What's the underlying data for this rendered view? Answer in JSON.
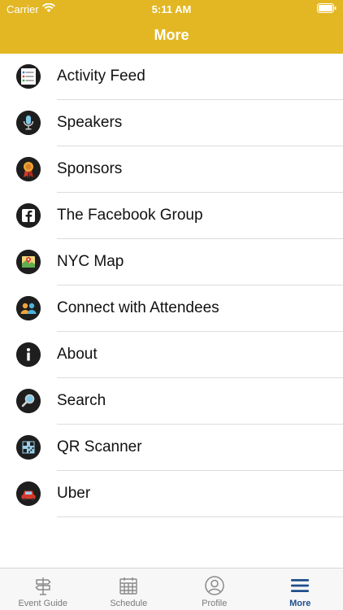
{
  "status_bar": {
    "carrier": "Carrier",
    "time": "5:11 AM"
  },
  "nav": {
    "title": "More"
  },
  "menu": {
    "items": [
      {
        "label": "Activity Feed",
        "icon": "activity-feed-icon"
      },
      {
        "label": "Speakers",
        "icon": "microphone-icon"
      },
      {
        "label": "Sponsors",
        "icon": "ribbon-award-icon"
      },
      {
        "label": "The Facebook Group",
        "icon": "facebook-icon"
      },
      {
        "label": "NYC Map",
        "icon": "map-icon"
      },
      {
        "label": "Connect with Attendees",
        "icon": "attendees-icon"
      },
      {
        "label": "About",
        "icon": "info-icon"
      },
      {
        "label": "Search",
        "icon": "search-icon"
      },
      {
        "label": "QR Scanner",
        "icon": "qr-code-icon"
      },
      {
        "label": "Uber",
        "icon": "car-icon"
      }
    ]
  },
  "tabbar": {
    "tabs": [
      {
        "label": "Event Guide",
        "icon": "signpost-icon",
        "active": false
      },
      {
        "label": "Schedule",
        "icon": "calendar-icon",
        "active": false
      },
      {
        "label": "Profile",
        "icon": "profile-icon",
        "active": false
      },
      {
        "label": "More",
        "icon": "hamburger-menu-icon",
        "active": true
      }
    ]
  },
  "colors": {
    "accent": "#E2B723",
    "active_tab": "#1f4e8c"
  }
}
